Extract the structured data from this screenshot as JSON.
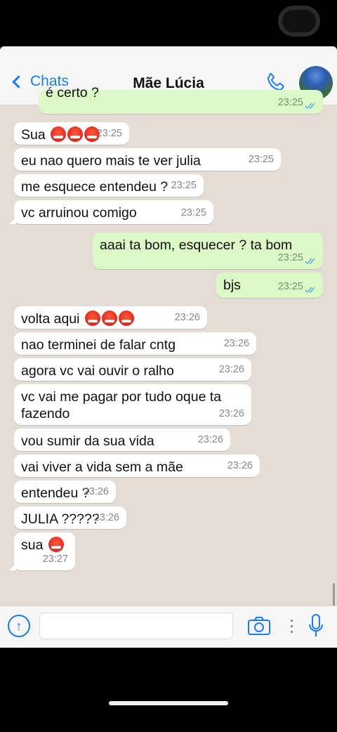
{
  "header": {
    "back_label": "Chats",
    "contact_name": "Mãe Lúcia",
    "accent_color": "#1a7cf2"
  },
  "messages": [
    {
      "dir": "out",
      "text": "é certo ?",
      "time": "23:25",
      "ticks": "double-blue",
      "partial": true
    },
    {
      "dir": "in",
      "text": "Sua",
      "emojis": 3,
      "time": "23:25"
    },
    {
      "dir": "in",
      "text": "eu nao quero mais te ver julia",
      "time": "23:25"
    },
    {
      "dir": "in",
      "text": "me esquece entendeu ?",
      "time": "23:25"
    },
    {
      "dir": "in",
      "text": "vc arruinou comigo",
      "time": "23:25"
    },
    {
      "dir": "out",
      "text": "aaai ta bom, esquecer ? ta bom",
      "time": "23:25",
      "ticks": "double-blue"
    },
    {
      "dir": "out",
      "text": "bjs",
      "time": "23:25",
      "ticks": "double-blue"
    },
    {
      "dir": "in",
      "text": "volta aqui",
      "emojis": 3,
      "time": "23:26"
    },
    {
      "dir": "in",
      "text": "nao terminei de falar cntg",
      "time": "23:26"
    },
    {
      "dir": "in",
      "text": "agora vc vai ouvir o ralho",
      "time": "23:26"
    },
    {
      "dir": "in",
      "text": "vc vai me pagar por tudo oque ta fazendo",
      "time": "23:26"
    },
    {
      "dir": "in",
      "text": "vou sumir da sua vida",
      "time": "23:26"
    },
    {
      "dir": "in",
      "text": "vai viver a vida sem a mãe",
      "time": "23:26"
    },
    {
      "dir": "in",
      "text": "entendeu ?",
      "time": "23:26"
    },
    {
      "dir": "in",
      "text": "JULIA ?????",
      "time": "23:26"
    },
    {
      "dir": "in",
      "text": "sua",
      "emojis": 1,
      "time": "23:27"
    }
  ],
  "input": {
    "placeholder": ""
  },
  "icons": {
    "back": "chevron-left-icon",
    "call": "phone-icon",
    "attach": "arrow-up-circle-icon",
    "camera": "camera-icon",
    "mic": "microphone-icon"
  }
}
